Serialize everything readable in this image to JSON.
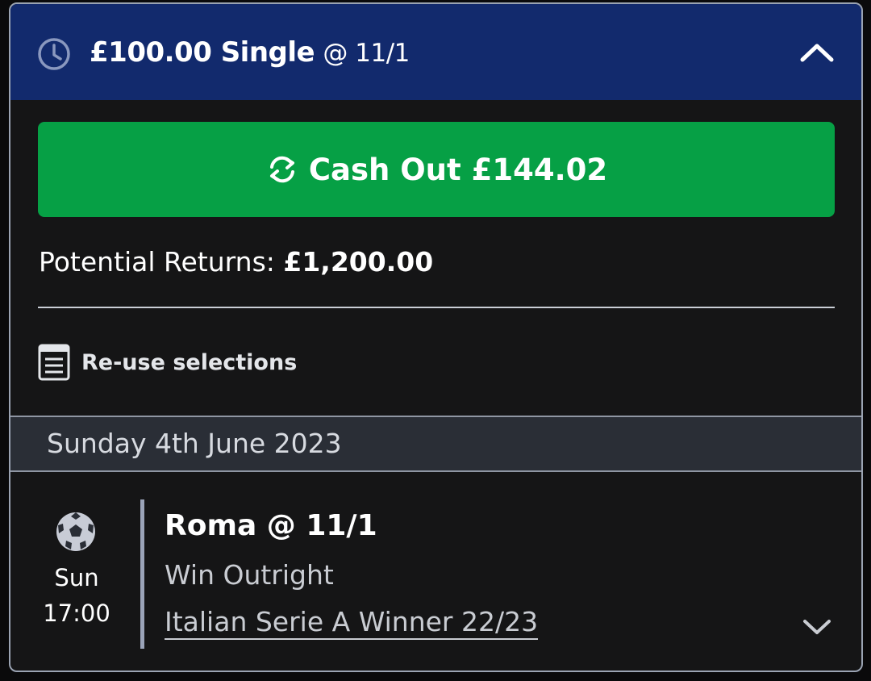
{
  "header": {
    "stake": "£100.00 Single",
    "odds": "@ 11/1",
    "icon": "clock-icon",
    "collapse_icon": "chevron-up-icon",
    "background": "#122a6d"
  },
  "cashout": {
    "label": "Cash Out £144.02",
    "icon": "refresh-icon",
    "color": "#06a045"
  },
  "returns": {
    "label": "Potential Returns:",
    "value": "£1,200.00"
  },
  "reuse": {
    "label": "Re-use selections",
    "icon": "document-icon"
  },
  "date_band": {
    "label": "Sunday 4th June 2023"
  },
  "selection": {
    "sport_icon": "football-icon",
    "day": "Sun",
    "time": "17:00",
    "name": "Roma @ 11/1",
    "market": "Win Outright",
    "event": "Italian Serie A Winner 22/23",
    "expand_icon": "chevron-down-icon"
  }
}
